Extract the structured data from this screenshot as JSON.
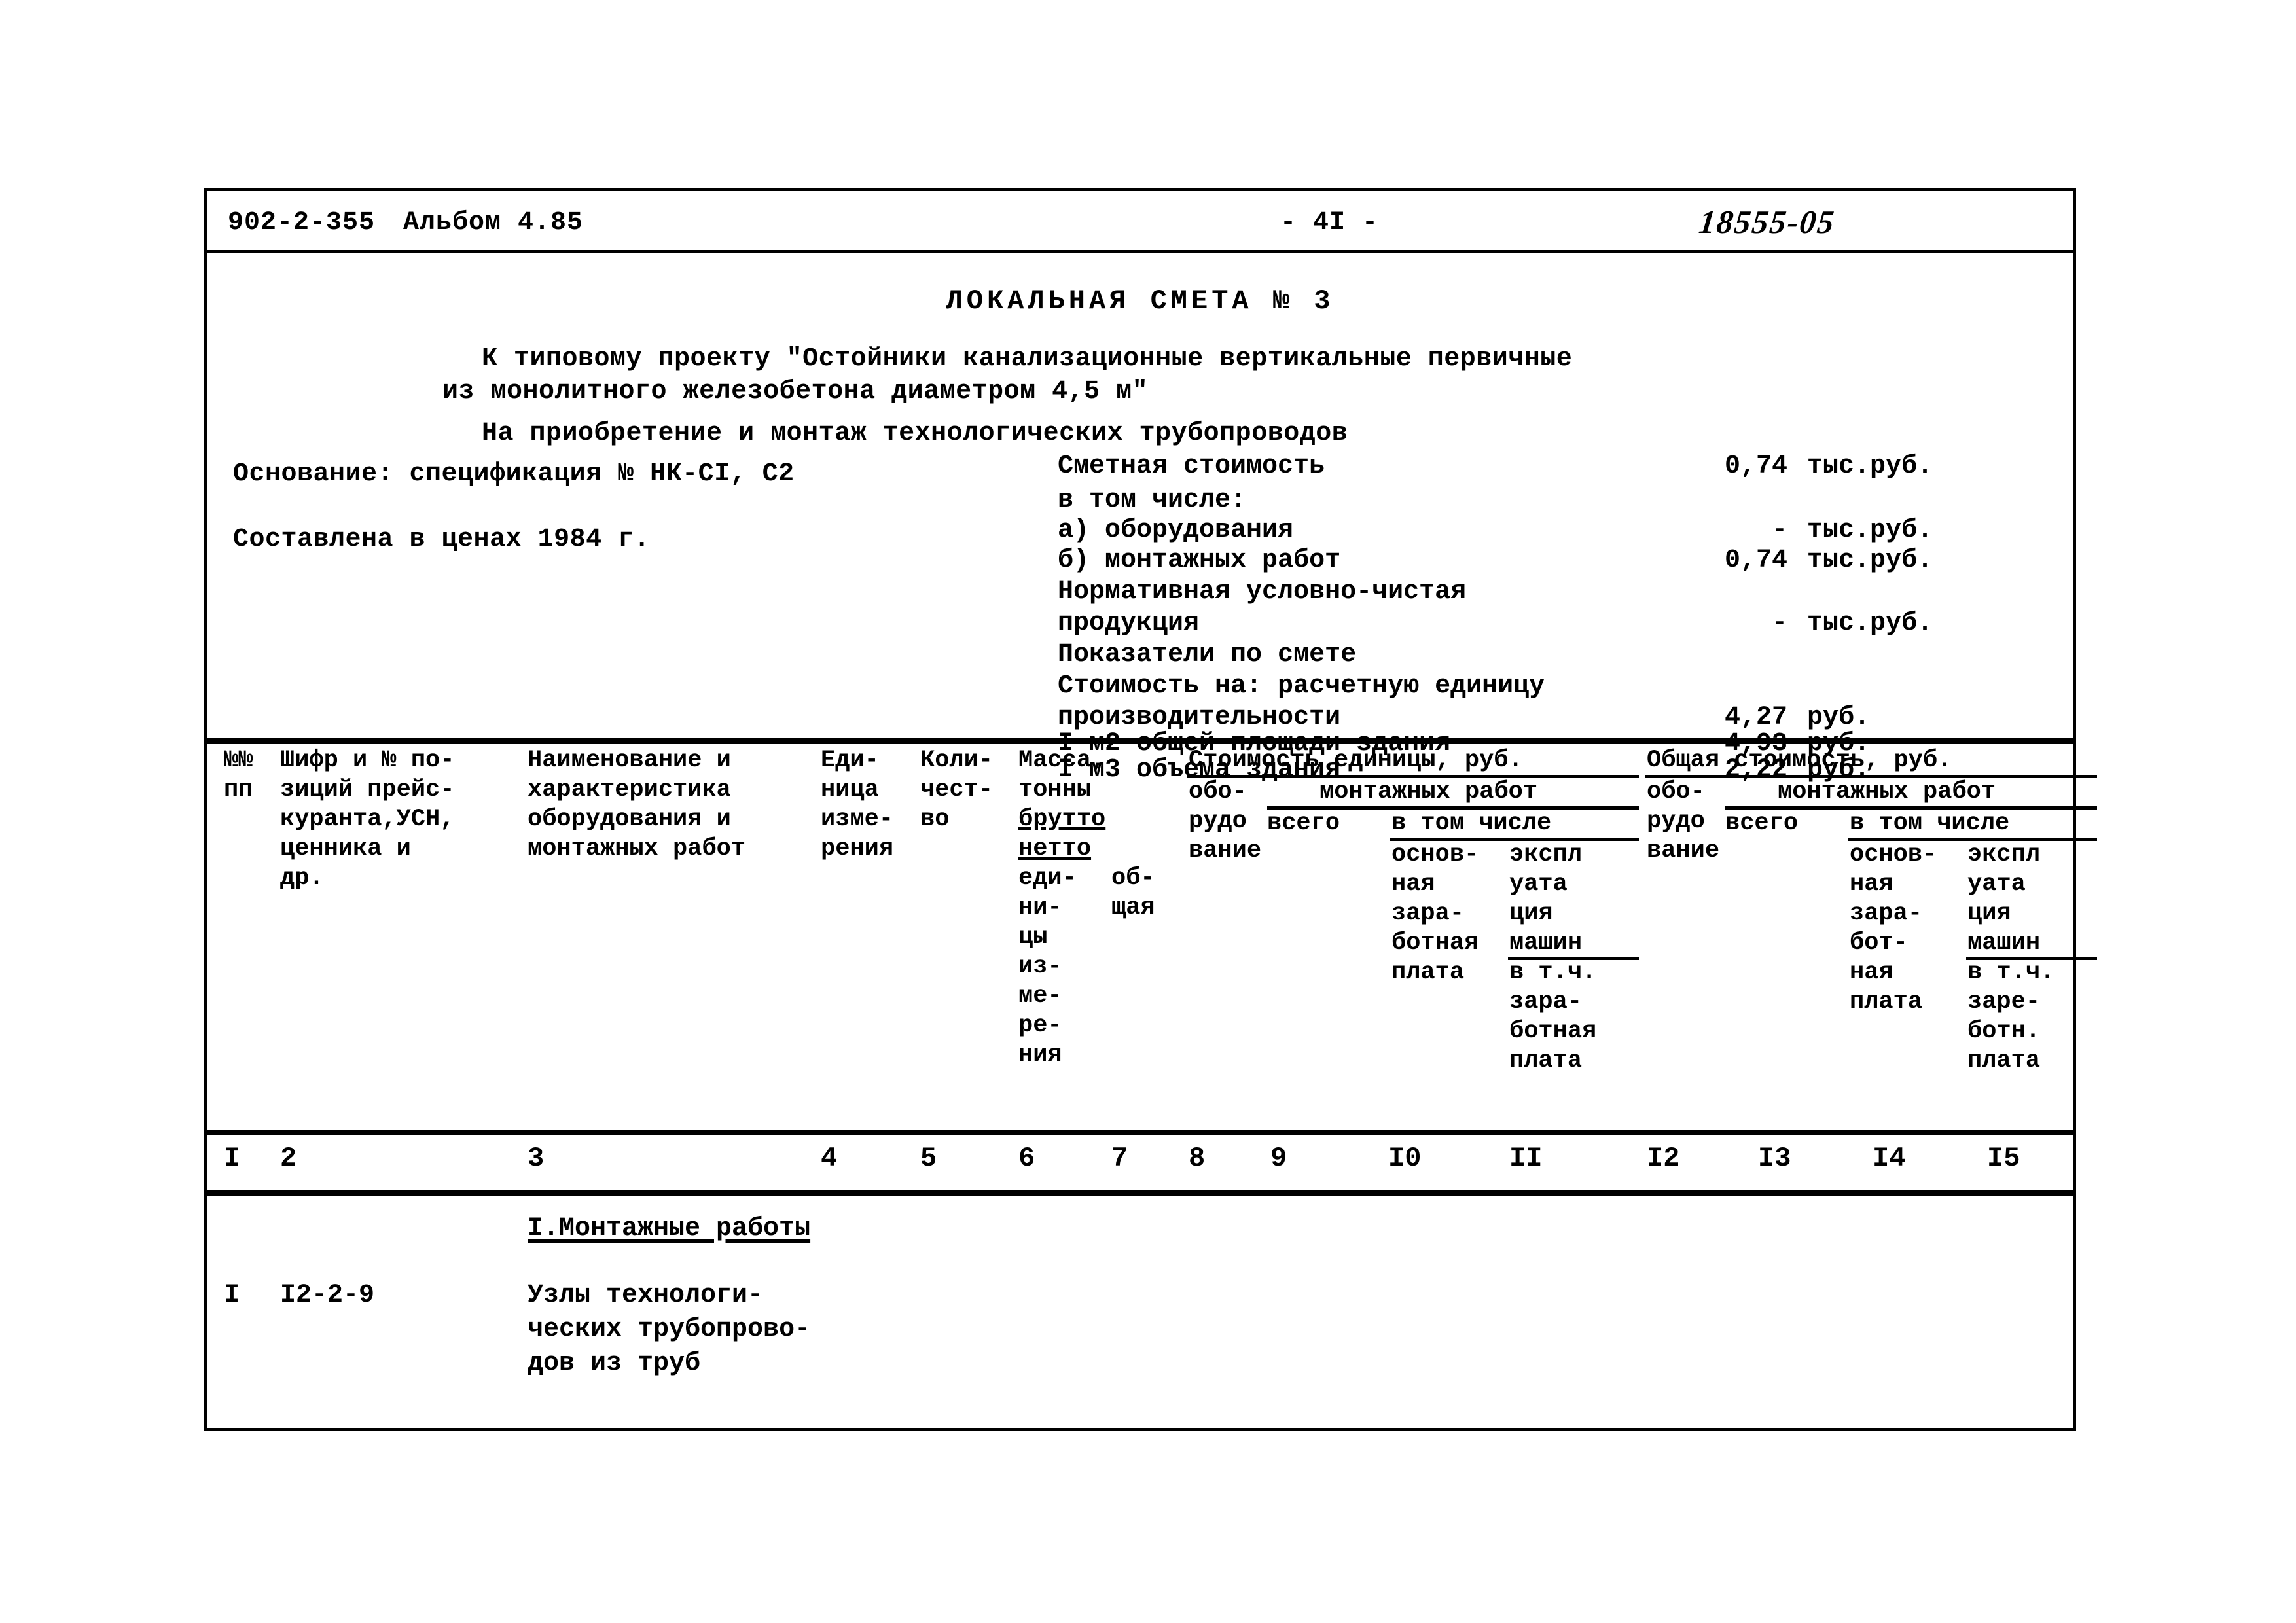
{
  "header": {
    "project_code": "902-2-355",
    "album": "Альбом 4.85",
    "page_marker": "- 4I -",
    "handwritten_number": "18555-05"
  },
  "summary": {
    "title": "ЛОКАЛЬНАЯ СМЕТА № 3",
    "project_line_1": "К типовому проекту \"Остойники канализационные вертикальные первичные",
    "project_line_2": "из монолитного железобетона диаметром 4,5 м\"",
    "purpose": "На приобретение и монтаж технологических трубопроводов",
    "basis": "Основание: спецификация № НК-СI, С2",
    "prices": "Составлена в ценах 1984 г.",
    "costs": [
      {
        "label": "Сметная стоимость",
        "value": "0,74",
        "unit": "тыс.руб."
      },
      {
        "label": "в том числе:",
        "value": "",
        "unit": ""
      },
      {
        "label": "а) оборудования",
        "value": "-",
        "unit": "тыс.руб."
      },
      {
        "label": "б) монтажных работ",
        "value": "0,74",
        "unit": "тыс.руб."
      },
      {
        "label": "Нормативная условно-чистая",
        "value": "",
        "unit": ""
      },
      {
        "label": "продукция",
        "value": "-",
        "unit": "тыс.руб."
      },
      {
        "label": "Показатели по смете",
        "value": "",
        "unit": ""
      },
      {
        "label": "Стоимость на: расчетную единицу",
        "value": "",
        "unit": ""
      },
      {
        "label": "производительности",
        "value": "4,27",
        "unit": "руб."
      },
      {
        "label": "I м2 общей площади здания",
        "value": "4,93",
        "unit": "руб."
      },
      {
        "label": "I м3 объема здания",
        "value": "2,22",
        "unit": "руб."
      }
    ]
  },
  "table": {
    "headers": {
      "c1": "№№\nпп",
      "c2": "Шифр и № по-\nзиций прейс-\nкуранта,УСН,\nценника и\nдр.",
      "c3": "Наименование и\nхарактеристика\nоборудования и\nмонтажных работ",
      "c4": "Еди-\nница\nизме-\nрения",
      "c5": "Коли-\nчест-\nво",
      "c6_top": "Масса,\nтонны",
      "c6_brutto": "брутто",
      "c6_netto": "нетто",
      "c6_tail": "еди-\nни-\nцы\nиз-\nме-\nре-\nния",
      "c7": "об-\nщая",
      "unit_cost_group": "Стоимость единицы, руб.",
      "total_cost_group": "Общая стоимость, руб.",
      "equipment": "обо-\nрудо\nвание",
      "install_group": "монтажных работ",
      "total_word": "всего",
      "incl_word": "в том числе",
      "base_wage": "основ-\nная\nзара-\nботная\nплата",
      "machine_op": "экспл\nуата\nция\nмашин",
      "machine_op_incl": "в т.ч.\nзара-\nботная\nплата",
      "equipment2": "обо-\nрудо\nвание",
      "base_wage2": "основ-\nная\nзара-\nбот-\nная\nплата",
      "machine_op2": "экспл\nуата\nция\nмашин",
      "machine_op2_incl": "в т.ч.\nзаре-\nботн.\nплата"
    },
    "column_numbers": [
      "I",
      "2",
      "3",
      "4",
      "5",
      "6",
      "7",
      "8",
      "9",
      "I0",
      "II",
      "I2",
      "I3",
      "I4",
      "I5"
    ],
    "section_title": "I.Монтажные работы",
    "rows": [
      {
        "no": "I",
        "code": "I2-2-9",
        "name": "Узлы технологи-\nческих трубопрово-\nдов из труб"
      }
    ]
  }
}
